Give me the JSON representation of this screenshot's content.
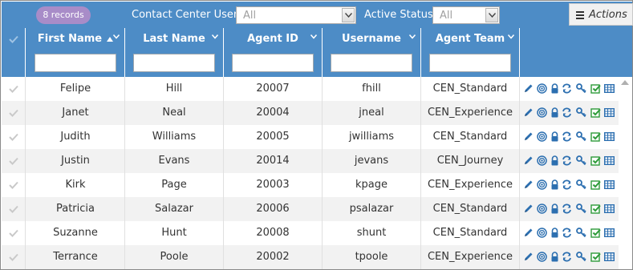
{
  "toolbar": {
    "records_badge": "8 records",
    "contact_center_label": "Contact Center User:",
    "contact_center_value": "All",
    "active_status_label": "Active Status:",
    "active_status_value": "All",
    "actions_label": "Actions"
  },
  "columns": [
    {
      "label": "First Name",
      "sorted": "ascending"
    },
    {
      "label": "Last Name"
    },
    {
      "label": "Agent ID"
    },
    {
      "label": "Username"
    },
    {
      "label": "Agent Team"
    }
  ],
  "rows": [
    {
      "first": "Felipe",
      "last": "Hill",
      "agent_id": "20007",
      "username": "fhill",
      "team": "CEN_Standard"
    },
    {
      "first": "Janet",
      "last": "Neal",
      "agent_id": "20004",
      "username": "jneal",
      "team": "CEN_Experience"
    },
    {
      "first": "Judith",
      "last": "Williams",
      "agent_id": "20005",
      "username": "jwilliams",
      "team": "CEN_Standard"
    },
    {
      "first": "Justin",
      "last": "Evans",
      "agent_id": "20014",
      "username": "jevans",
      "team": "CEN_Journey"
    },
    {
      "first": "Kirk",
      "last": "Page",
      "agent_id": "20003",
      "username": "kpage",
      "team": "CEN_Experience"
    },
    {
      "first": "Patricia",
      "last": "Salazar",
      "agent_id": "20006",
      "username": "psalazar",
      "team": "CEN_Standard"
    },
    {
      "first": "Suzanne",
      "last": "Hunt",
      "agent_id": "20008",
      "username": "shunt",
      "team": "CEN_Standard"
    },
    {
      "first": "Terrance",
      "last": "Poole",
      "agent_id": "20002",
      "username": "tpoole",
      "team": "CEN_Experience"
    }
  ],
  "row_actions": [
    "edit-icon",
    "target-icon",
    "lock-icon",
    "refresh-icon",
    "key-icon",
    "checkbox-icon",
    "grid-icon"
  ],
  "colors": {
    "header_bg": "#4d8cc6",
    "badge_bg": "#a88cc8",
    "action_icon": "#2c6fb0",
    "check_green": "#2e9b3a"
  }
}
